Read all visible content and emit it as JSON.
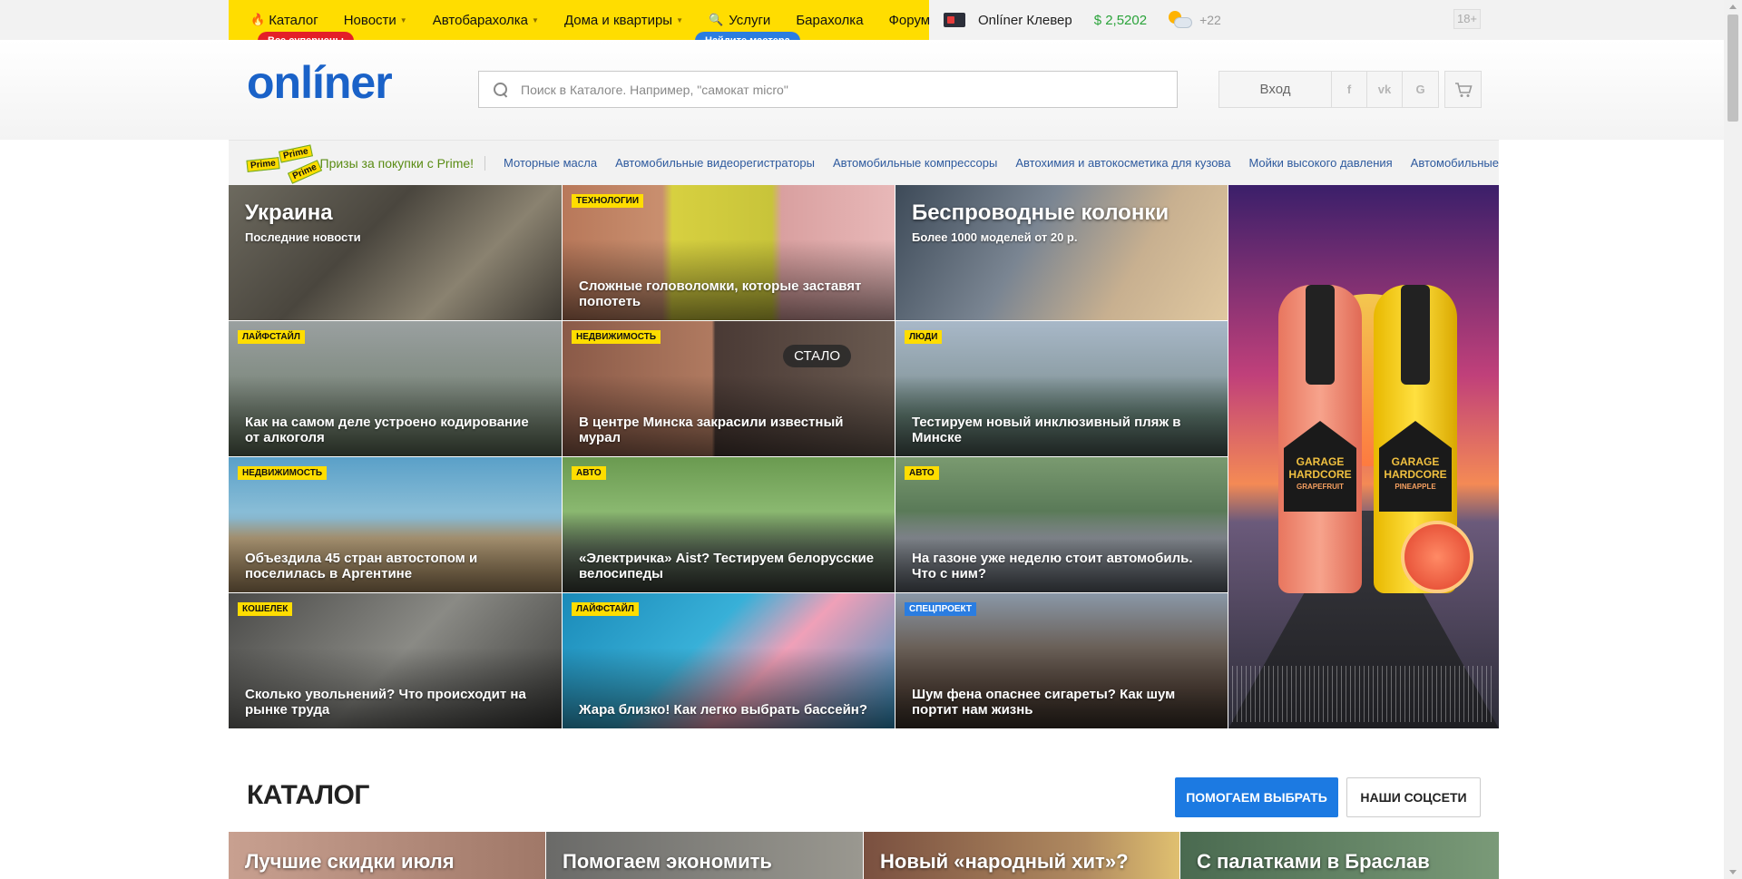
{
  "topnav": {
    "items": [
      {
        "label": "Каталог",
        "icon": "flame-icon",
        "caret": false
      },
      {
        "label": "Новости",
        "caret": true
      },
      {
        "label": "Автобарахолка",
        "caret": true
      },
      {
        "label": "Дома и квартиры",
        "caret": true
      },
      {
        "label": "Услуги",
        "icon": "wrench-icon",
        "caret": false
      },
      {
        "label": "Барахолка",
        "caret": false
      },
      {
        "label": "Форум",
        "caret": false
      }
    ],
    "badge_catalog": "Все суперцены",
    "badge_services": "Найдите мастера",
    "clever": "Onlíner Клевер",
    "currency_rate": "$ 2,5202",
    "temperature": "+22",
    "age_rating": "18+",
    "colors": {
      "yellow": "#ffdd00",
      "red": "#e41f28",
      "blue": "#2a7de1",
      "green": "#2aa33a"
    }
  },
  "header": {
    "logo_main": "onli",
    "logo_accent": "́",
    "logo_tail": "ner",
    "search_placeholder": "Поиск в Каталоге. Например, \"самокат micro\"",
    "login_label": "Вход",
    "social": [
      "f",
      "vk",
      "G"
    ],
    "cart_icon": "cart-icon"
  },
  "prime": {
    "badge_words": [
      "Prime",
      "Prime",
      "Prime"
    ],
    "title": "Призы за покупки с Prime!",
    "links": [
      "Моторные масла",
      "Автомобильные видеорегистраторы",
      "Автомобильные компрессоры",
      "Автохимия и автокосметика для кузова",
      "Мойки высокого давления",
      "Автомобильные"
    ]
  },
  "news": {
    "featured": [
      {
        "title": "Украина",
        "subtitle": "Последние новости"
      },
      {
        "tag": "Технологии",
        "caption": "Сложные головоломки, которые заставят попотеть"
      },
      {
        "title": "Беспроводные колонки",
        "subtitle": "Более 1000 моделей от 20 р."
      }
    ],
    "tiles": [
      {
        "tag": "Лайфстайл",
        "caption": "Как на самом деле устроено кодирование от алкоголя"
      },
      {
        "tag": "Недвижимость",
        "caption": "В центре Минска закрасили известный мурал",
        "badge": "СТАЛО"
      },
      {
        "tag": "Люди",
        "caption": "Тестируем новый инклюзивный пляж в Минске"
      },
      {
        "tag": "Недвижимость",
        "caption": "Объездила 45 стран автостопом и поселилась в Аргентине"
      },
      {
        "tag": "Авто",
        "caption": "«Электричка» Aist? Тестируем белорусские велосипеды"
      },
      {
        "tag": "Авто",
        "caption": "На газоне уже неделю стоит автомобиль. Что с ним?"
      },
      {
        "tag": "Кошелек",
        "caption": "Сколько увольнений? Что происходит на рынке труда"
      },
      {
        "tag": "Лайфстайл",
        "caption": "Жара близко! Как легко выбрать бассейн?"
      },
      {
        "tag": "Спецпроект",
        "caption": "Шум фена опаснее сигареты? Как шум портит нам жизнь"
      }
    ],
    "ad": {
      "brand": "GARAGE",
      "line": "HARDCORE",
      "flavor_left": "GRAPEFRUIT",
      "flavor_right": "PINEAPPLE"
    }
  },
  "catalog": {
    "title": "КАТАЛОГ",
    "help_button": "ПОМОГАЕМ ВЫБРАТЬ",
    "social_button": "НАШИ СОЦСЕТИ",
    "promos": [
      "Лучшие скидки июля",
      "Помогаем экономить",
      "Новый «народный хит»?",
      "С палатками в Браслав"
    ]
  }
}
